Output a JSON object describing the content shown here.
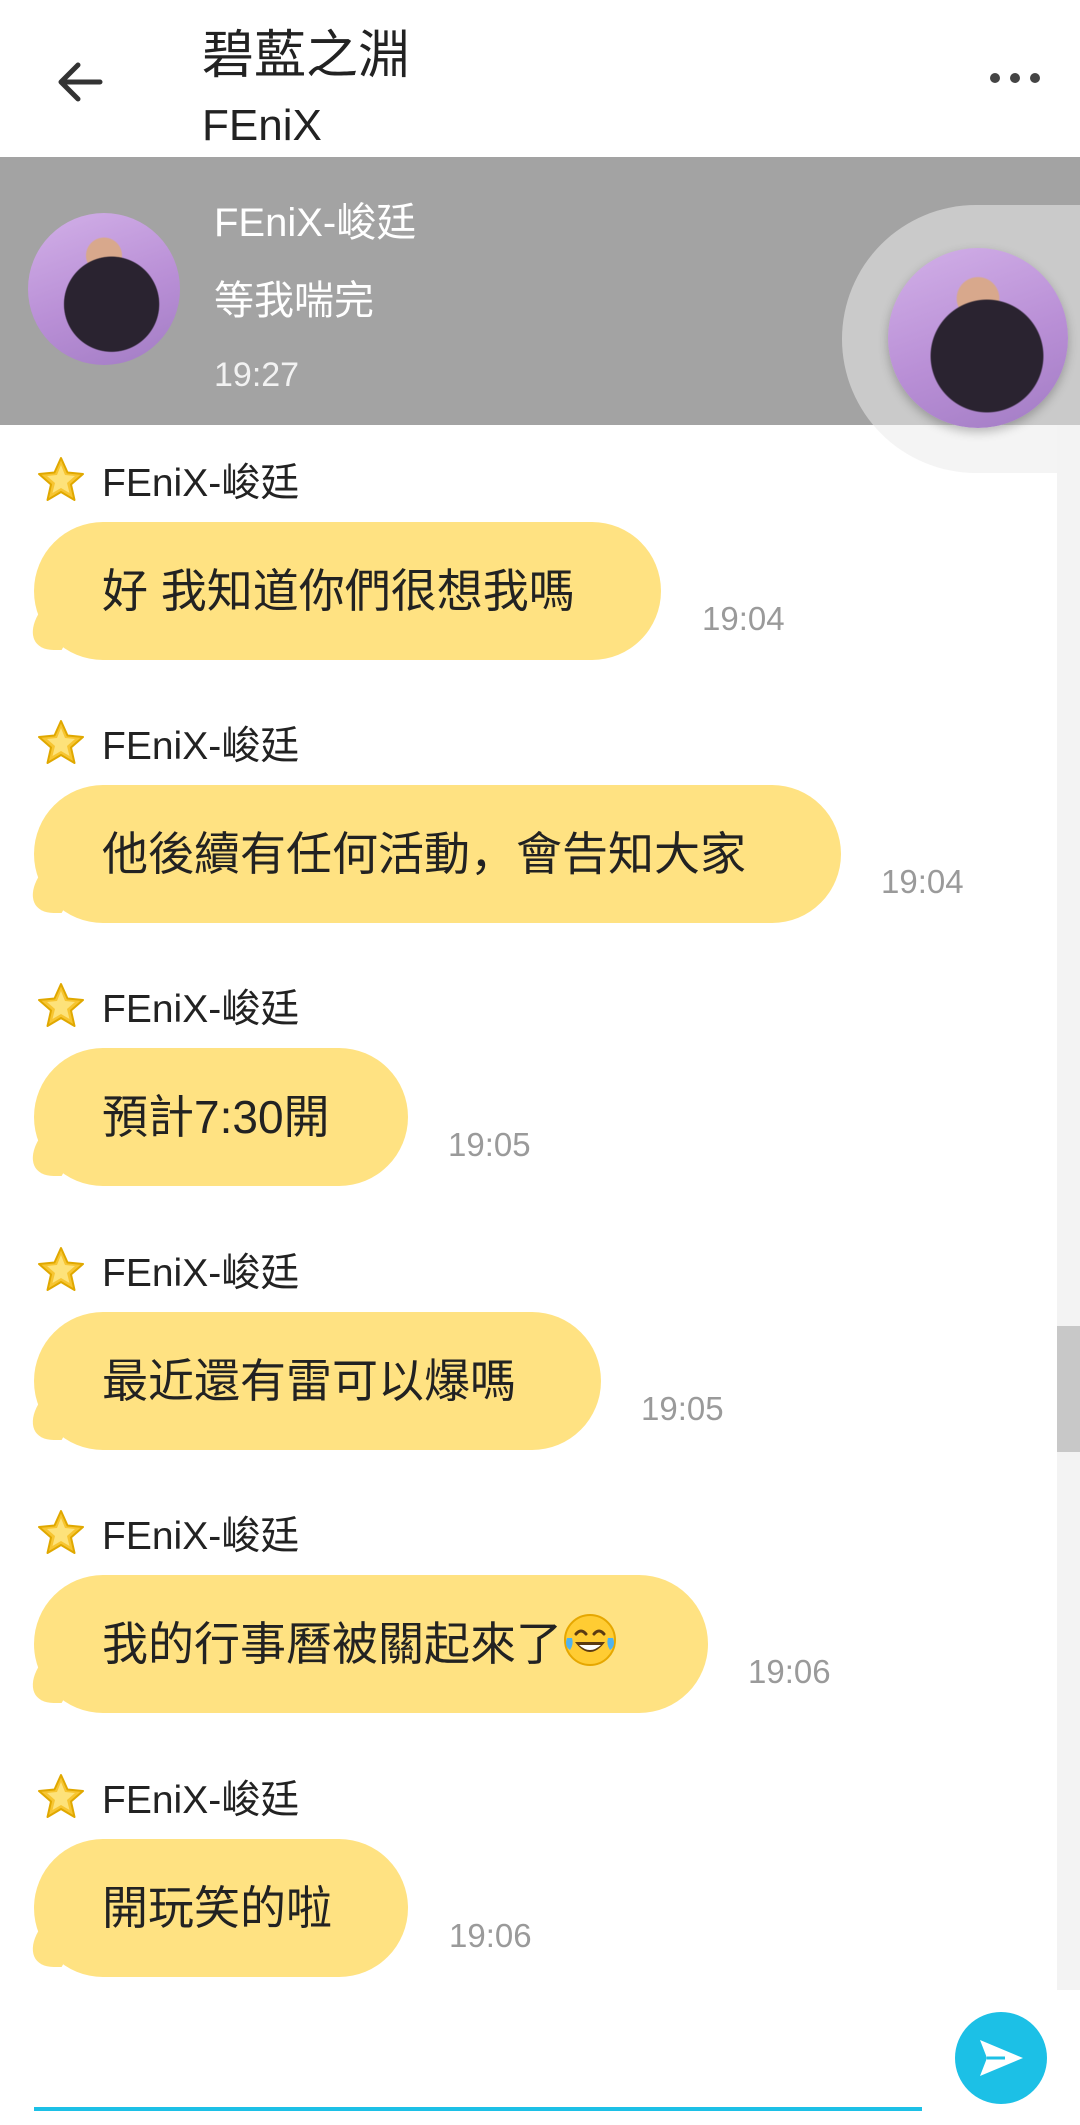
{
  "header": {
    "title": "碧藍之淵",
    "subtitle": "FEniX"
  },
  "pinned": {
    "sender": "FEniX-峻廷",
    "message": "等我喘完",
    "time": "19:27"
  },
  "messages": [
    {
      "sender": "FEniX-峻廷",
      "text": "好 我知道你們很想我嗎",
      "time": "19:04"
    },
    {
      "sender": "FEniX-峻廷",
      "text": "他後續有任何活動，會告知大家",
      "time": "19:04"
    },
    {
      "sender": "FEniX-峻廷",
      "text": "預計7:30開",
      "time": "19:05"
    },
    {
      "sender": "FEniX-峻廷",
      "text": "最近還有雷可以爆嗎",
      "time": "19:05"
    },
    {
      "sender": "FEniX-峻廷",
      "text": "我的行事曆被關起來了",
      "emoji": "face-with-tears-of-joy",
      "time": "19:06"
    },
    {
      "sender": "FEniX-峻廷",
      "text": "開玩笑的啦",
      "time": "19:06"
    }
  ],
  "composer": {
    "value": "",
    "placeholder": ""
  },
  "colors": {
    "bubble": "#ffe282",
    "accent": "#1cc0e6",
    "banner": "#a3a3a3"
  },
  "icons": {
    "back": "arrow-left-icon",
    "more": "more-dots-icon",
    "star": "star-icon",
    "send": "send-icon"
  }
}
